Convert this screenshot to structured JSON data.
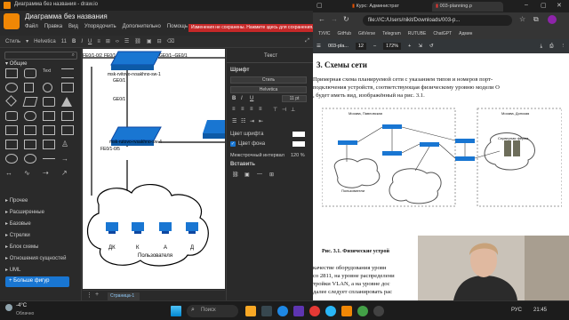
{
  "drawio": {
    "window_title": "Диаграмма без названия - draw.io",
    "doc_name": "Диаграмма без названия",
    "menu": [
      "Файл",
      "Вид",
      "Правка",
      "Вид",
      "Упорядочить",
      "Дополнительно",
      "Помощь"
    ],
    "unsaved_banner": "Изменения не сохранены. Нажмите здесь для сохранения.",
    "toolbar": {
      "style": "Стиль",
      "font": "Helvetica",
      "font_size": "11"
    },
    "sidebar": {
      "section_general": "Общие",
      "categories": [
        "Прочее",
        "Расширенные",
        "Базовые",
        "Стрелки",
        "Блок схемы",
        "Отношения сущностей",
        "UML"
      ],
      "more_shapes": "+ Больше фигур"
    },
    "canvas": {
      "link_labels": [
        "FE0/1",
        "GE0/1--GE0/1",
        "GE0/1",
        "GE0/1",
        "FE0/1-0/5",
        "FE0/1-0/24"
      ],
      "switch_labels": [
        "msk-rvitovo-rvsakhno-sw-1",
        "msk-rutovo-rvsakhno-sw-4"
      ],
      "pc_labels": [
        "ДК",
        "К",
        "А",
        "Д"
      ],
      "cloud_label": "Пользователя"
    },
    "page_tab": "Страница-1",
    "format_panel": {
      "tab_text": "Текст",
      "font_heading": "Шрифт",
      "style_box": "Стиль",
      "font_box": "Helvetica",
      "size_box": "11 pt",
      "font_color": "Цвет шрифта",
      "bg_color": "Цвет фона",
      "line_spacing": "Межстрочный интервал",
      "line_spacing_val": "120 %",
      "insert": "Вставить"
    }
  },
  "browser": {
    "tabs": [
      "Курс: Администрат",
      "003-planning.p"
    ],
    "url": "file:///C:/Users/nikit/Downloads/003-p...",
    "bookmarks": [
      "ТУИС",
      "GitHub",
      "GitVerse",
      "Telegram",
      "RUTUBE",
      "ChatGPT",
      "Админ"
    ],
    "pdf": {
      "filename": "003-pla...",
      "page_num": "12",
      "zoom": "172%",
      "heading": "Схемы сети",
      "para1": [
        "Примерная схема планируемой сети с указанием типов и номеров порт-",
        "подключения устройств, соответствующая физическому уровню модели О",
        ", будет иметь вид, изображённый на рис. 3.1."
      ],
      "fig_caption": "Рис. 3.1. Физические устрой",
      "para2": [
        "качестве оборудования уровн",
        "co 2811, на уровне распределени",
        "тройки VLAN, а на уровне дос",
        "далее следует спланировать рас"
      ],
      "fig_labels": [
        "Москва, Павловская",
        "Москва, Донская",
        "Пользователи",
        "Серверная ферма"
      ]
    }
  },
  "taskbar": {
    "weather_temp": "-4°C",
    "weather_desc": "Облачно",
    "search_placeholder": "Поиск",
    "lang": "РУС",
    "time": "21:45"
  }
}
